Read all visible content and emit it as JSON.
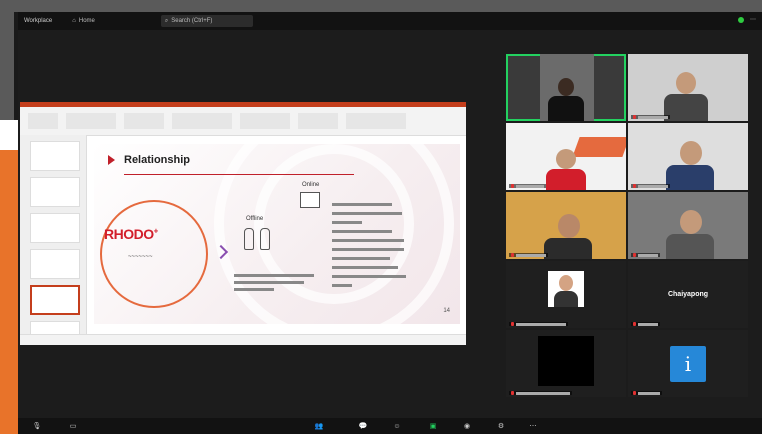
{
  "window": {
    "app_label": "Workplace",
    "home_label": "Home",
    "search_placeholder": "Search (Ctrl+F)"
  },
  "share": {
    "slide_title": "Relationship",
    "brand": "RHODO",
    "brand_plus": "+",
    "offline_label": "Offline",
    "online_label": "Online",
    "page_number": "14"
  },
  "participants": [
    {
      "id": "p1",
      "active": true
    },
    {
      "id": "p2"
    },
    {
      "id": "p3"
    },
    {
      "id": "p4"
    },
    {
      "id": "p5"
    },
    {
      "id": "p6"
    },
    {
      "id": "p7"
    },
    {
      "id": "p8",
      "display_name": "Chaiyapong"
    },
    {
      "id": "p9"
    },
    {
      "id": "p10"
    }
  ],
  "colors": {
    "accent_green": "#23d160",
    "brand_red": "#d21e2b",
    "avatar_blue": "#2688d8"
  }
}
